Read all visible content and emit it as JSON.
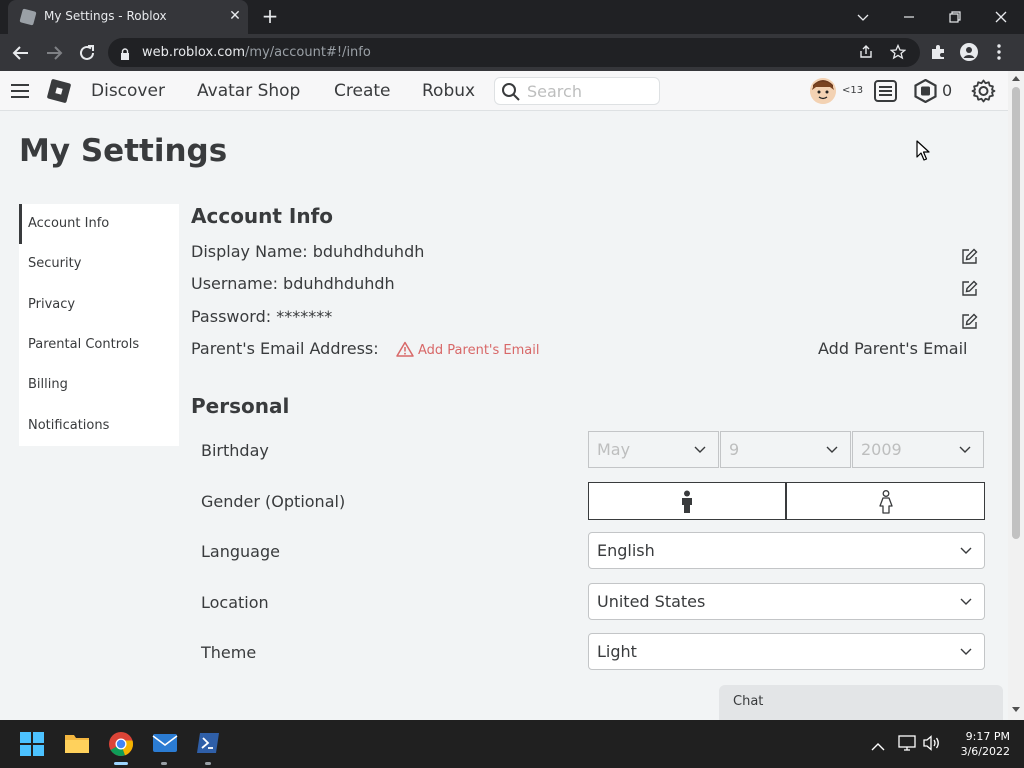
{
  "browser": {
    "tab_title": "My Settings - Roblox",
    "url_host": "web.roblox.com",
    "url_path": "/my/account#!/info"
  },
  "header": {
    "nav": [
      "Discover",
      "Avatar Shop",
      "Create",
      "Robux"
    ],
    "search_placeholder": "Search",
    "age_bracket": "<13",
    "robux_count": "0"
  },
  "page": {
    "title": "My Settings"
  },
  "sidebar": {
    "items": [
      {
        "label": "Account Info",
        "active": true
      },
      {
        "label": "Security"
      },
      {
        "label": "Privacy"
      },
      {
        "label": "Parental Controls"
      },
      {
        "label": "Billing"
      },
      {
        "label": "Notifications"
      }
    ]
  },
  "account_info": {
    "title": "Account Info",
    "display_name": "Display Name: bduhdhduhdh",
    "username": "Username: bduhdhduhdh",
    "password": "Password: *******",
    "parent_email_label": "Parent's Email Address:",
    "add_parent_email_link": "Add Parent's Email",
    "add_parent_email_button": "Add Parent's Email"
  },
  "personal": {
    "title": "Personal",
    "birthday_label": "Birthday",
    "birth_month": "May",
    "birth_day": "9",
    "birth_year": "2009",
    "gender_label": "Gender (Optional)",
    "language_label": "Language",
    "language_value": "English",
    "location_label": "Location",
    "location_value": "United States",
    "theme_label": "Theme",
    "theme_value": "Light"
  },
  "chat": {
    "label": "Chat"
  },
  "taskbar": {
    "time": "9:17 PM",
    "date": "3/6/2022"
  },
  "colors": {
    "warning": "#d86868",
    "text": "#393b3d",
    "page_bg": "#f2f4f5"
  }
}
